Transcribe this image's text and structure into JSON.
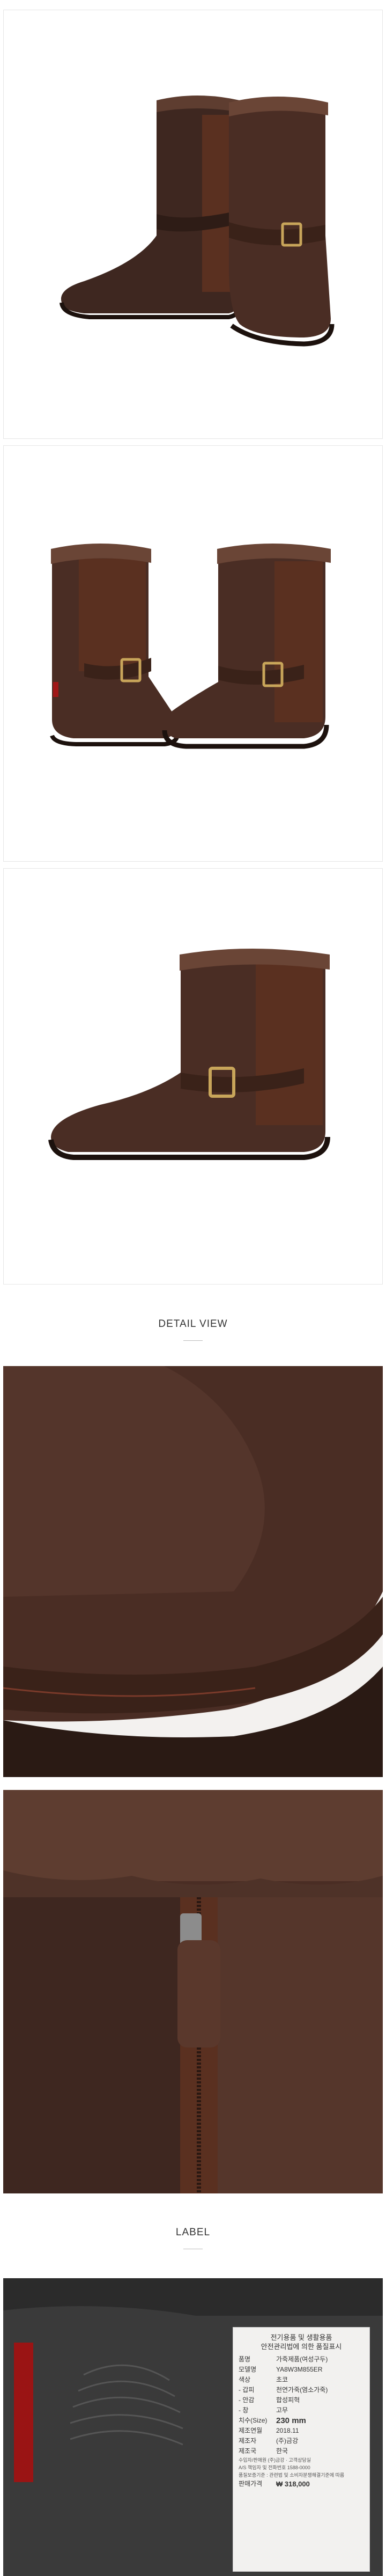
{
  "sections": {
    "detail_view": "DETAIL VIEW",
    "label": "LABEL"
  },
  "label_card": {
    "header_line1": "전기용품 및 생활용품",
    "header_line2": "안전관리법에 의한 품질표시",
    "rows": [
      {
        "key": "품명",
        "value": "가죽제품(여성구두)"
      },
      {
        "key": "모델명",
        "value": "YA8W3M855ER"
      },
      {
        "key": "색상",
        "value": "초코"
      },
      {
        "key": "- 갑피",
        "value": "천연가죽(염소가죽)"
      },
      {
        "key": "- 안감",
        "value": "합성피혁"
      },
      {
        "key": "- 창",
        "value": "고무"
      },
      {
        "key": "치수(Size)",
        "value": "230 mm"
      },
      {
        "key": "제조연월",
        "value": "2018.11"
      },
      {
        "key": "제조자",
        "value": "(주)금강"
      },
      {
        "key": "제조국",
        "value": "한국"
      }
    ],
    "notes": [
      "수입자/판매원  (주)금강 · 고객상담실",
      "A/S 책임자 및 전화번호 1588-0000",
      "품질보증기준 : 관련법 및 소비자분쟁해결기준에 따름"
    ],
    "price_label": "판매가격",
    "price_value": "₩ 318,000"
  },
  "colors": {
    "leather": "#4a2d24",
    "suede": "#5a3020",
    "fur": "#5e3d30",
    "buckle": "#c8a55a",
    "background": "#ffffff"
  }
}
